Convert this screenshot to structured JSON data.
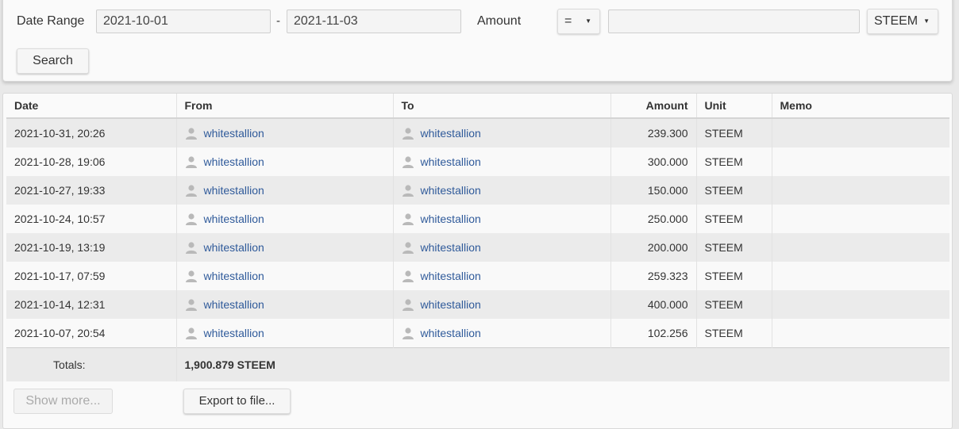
{
  "filters": {
    "date_range_label": "Date Range",
    "date_from": "2021-10-01",
    "date_separator": "-",
    "date_to": "2021-11-03",
    "amount_label": "Amount",
    "operator": "=",
    "amount_value": "",
    "currency": "STEEM",
    "search_label": "Search"
  },
  "table": {
    "headers": {
      "date": "Date",
      "from": "From",
      "to": "To",
      "amount": "Amount",
      "unit": "Unit",
      "memo": "Memo"
    },
    "rows": [
      {
        "date": "2021-10-31, 20:26",
        "from": "whitestallion",
        "to": "whitestallion",
        "amount": "239.300",
        "unit": "STEEM",
        "memo": ""
      },
      {
        "date": "2021-10-28, 19:06",
        "from": "whitestallion",
        "to": "whitestallion",
        "amount": "300.000",
        "unit": "STEEM",
        "memo": ""
      },
      {
        "date": "2021-10-27, 19:33",
        "from": "whitestallion",
        "to": "whitestallion",
        "amount": "150.000",
        "unit": "STEEM",
        "memo": ""
      },
      {
        "date": "2021-10-24, 10:57",
        "from": "whitestallion",
        "to": "whitestallion",
        "amount": "250.000",
        "unit": "STEEM",
        "memo": ""
      },
      {
        "date": "2021-10-19, 13:19",
        "from": "whitestallion",
        "to": "whitestallion",
        "amount": "200.000",
        "unit": "STEEM",
        "memo": ""
      },
      {
        "date": "2021-10-17, 07:59",
        "from": "whitestallion",
        "to": "whitestallion",
        "amount": "259.323",
        "unit": "STEEM",
        "memo": ""
      },
      {
        "date": "2021-10-14, 12:31",
        "from": "whitestallion",
        "to": "whitestallion",
        "amount": "400.000",
        "unit": "STEEM",
        "memo": ""
      },
      {
        "date": "2021-10-07, 20:54",
        "from": "whitestallion",
        "to": "whitestallion",
        "amount": "102.256",
        "unit": "STEEM",
        "memo": ""
      }
    ],
    "totals_label": "Totals:",
    "totals_value": "1,900.879 STEEM"
  },
  "footer": {
    "show_more_label": "Show more...",
    "export_label": "Export to file..."
  },
  "icons": {
    "user": "user-icon",
    "caret": "caret-down-icon"
  },
  "colors": {
    "link": "#2f5a9a",
    "row_odd": "#ebebeb",
    "row_even": "#f9f9f9"
  }
}
